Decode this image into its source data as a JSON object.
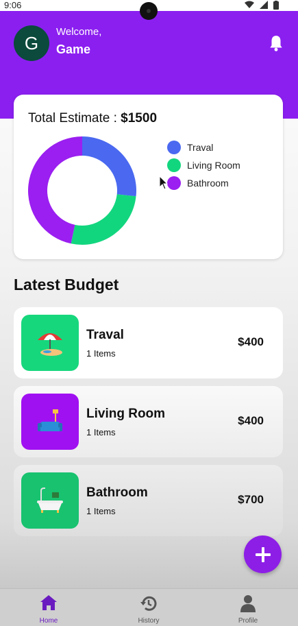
{
  "status_bar": {
    "time": "9:06"
  },
  "header": {
    "avatar_letter": "G",
    "welcome": "Welcome,",
    "username": "Game",
    "bell_icon": "bell-icon"
  },
  "colors": {
    "header_purple": "#8b1ff0",
    "travel_blue": "#4a69f0",
    "living_green": "#12d67e",
    "bathroom_purple": "#9b1ff0"
  },
  "estimate": {
    "label": "Total Estimate : ",
    "total": "$1500",
    "legend": [
      {
        "label": "Traval",
        "color": "#4a69f0"
      },
      {
        "label": "Living Room",
        "color": "#12d67e"
      },
      {
        "label": "Bathroom",
        "color": "#9b1ff0"
      }
    ]
  },
  "chart_data": {
    "type": "pie",
    "categories": [
      "Traval",
      "Living Room",
      "Bathroom"
    ],
    "values": [
      400,
      400,
      700
    ],
    "title": "Total Estimate : $1500"
  },
  "latest_budget": {
    "title": "Latest Budget",
    "items": [
      {
        "name": "Traval",
        "count": "1 Items",
        "amount": "$400",
        "icon": "beach-umbrella-icon",
        "icon_bg": "#17d77d"
      },
      {
        "name": "Living Room",
        "count": "1 Items",
        "amount": "$400",
        "icon": "sofa-lamp-icon",
        "icon_bg": "#a011f2"
      },
      {
        "name": "Bathroom",
        "count": "1 Items",
        "amount": "$700",
        "icon": "bathtub-icon",
        "icon_bg": "#18c26f"
      }
    ]
  },
  "fab": {
    "icon": "plus-icon"
  },
  "bottom_nav": {
    "items": [
      {
        "label": "Home",
        "icon": "home-icon",
        "active": true
      },
      {
        "label": "History",
        "icon": "history-icon",
        "active": false
      },
      {
        "label": "Profile",
        "icon": "profile-icon",
        "active": false
      }
    ]
  }
}
